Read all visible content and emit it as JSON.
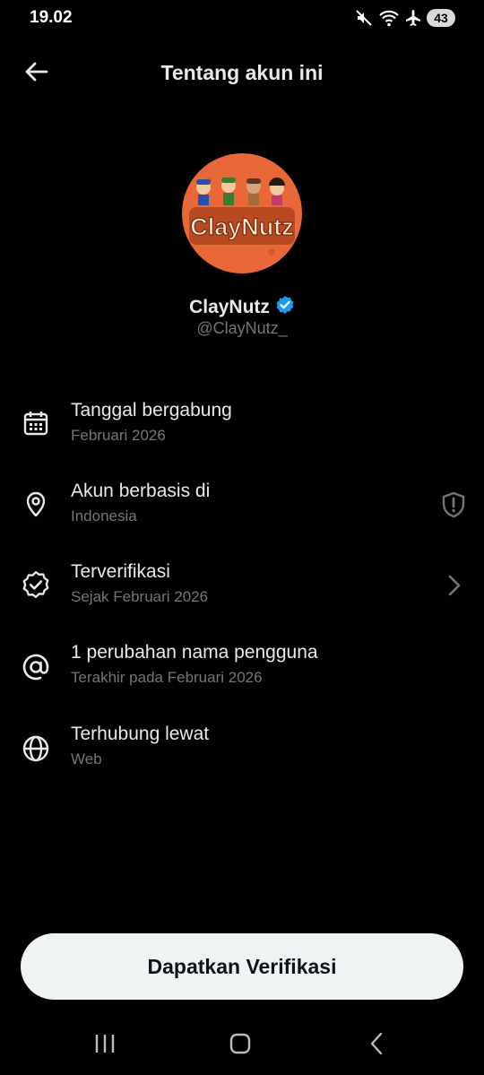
{
  "status_bar": {
    "time": "19.02",
    "battery": "43",
    "icons": [
      "mute-icon",
      "wifi-icon",
      "airplane-icon",
      "battery-icon"
    ]
  },
  "header": {
    "title": "Tentang akun ini",
    "back_icon": "arrow-left-icon"
  },
  "profile": {
    "avatar_text": "ClayNutz",
    "display_name": "ClayNutz",
    "handle": "@ClayNutz_",
    "verified_icon": "verified-badge-icon"
  },
  "info_items": [
    {
      "icon": "calendar-icon",
      "title": "Tanggal bergabung",
      "subtitle": "Februari 2026"
    },
    {
      "icon": "location-pin-icon",
      "title": "Akun berbasis di",
      "subtitle": "Indonesia",
      "right_icon": "shield-alert-icon"
    },
    {
      "icon": "verified-check-icon",
      "title": "Terverifikasi",
      "subtitle": "Sejak Februari 2026",
      "right_icon": "chevron-right-icon"
    },
    {
      "icon": "at-sign-icon",
      "title": "1 perubahan nama pengguna",
      "subtitle": "Terakhir pada Februari 2026"
    },
    {
      "icon": "globe-icon",
      "title": "Terhubung lewat",
      "subtitle": "Web"
    }
  ],
  "cta": {
    "label": "Dapatkan Verifikasi"
  },
  "nav_bar": {
    "icons": [
      "recents-icon",
      "home-icon",
      "back-icon"
    ]
  },
  "colors": {
    "background": "#000000",
    "primary_text": "#e7e9ea",
    "secondary_text": "#71767b",
    "verified_blue": "#1d9bf0",
    "button_bg": "#eff3f4",
    "avatar_orange": "#e8683a"
  }
}
